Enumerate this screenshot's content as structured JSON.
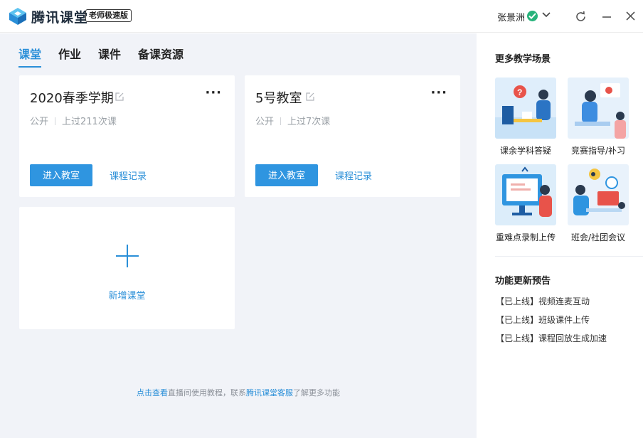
{
  "app": {
    "brand": "腾讯课堂",
    "edition": "老师极速版",
    "user_name": "张景洲",
    "accent": "#2a8fd8"
  },
  "tabs": [
    {
      "label": "课堂",
      "active": true
    },
    {
      "label": "作业",
      "active": false
    },
    {
      "label": "课件",
      "active": false
    },
    {
      "label": "备课资源",
      "active": false
    }
  ],
  "classrooms": [
    {
      "title": "2020春季学期",
      "visibility": "公开",
      "sessions": "上过211次课",
      "enter_label": "进入教室",
      "record_label": "课程记录"
    },
    {
      "title": "5号教室",
      "visibility": "公开",
      "sessions": "上过7次课",
      "enter_label": "进入教室",
      "record_label": "课程记录"
    }
  ],
  "add_classroom_label": "新增课堂",
  "footer": {
    "link1": "点击查看",
    "text1": "直播间使用教程，联系",
    "link2": "腾讯课堂客服",
    "text2": "了解更多功能"
  },
  "side": {
    "scenes_title": "更多教学场景",
    "scenes": [
      {
        "label": "课余学科答疑",
        "icon": "qa-illustration"
      },
      {
        "label": "竞赛指导/补习",
        "icon": "tutoring-illustration"
      },
      {
        "label": "重难点录制上传",
        "icon": "record-upload-illustration"
      },
      {
        "label": "班会/社团会议",
        "icon": "meeting-illustration"
      }
    ],
    "updates_title": "功能更新预告",
    "updates": [
      "【已上线】视频连麦互动",
      "【已上线】班级课件上传",
      "【已上线】课程回放生成加速"
    ]
  }
}
